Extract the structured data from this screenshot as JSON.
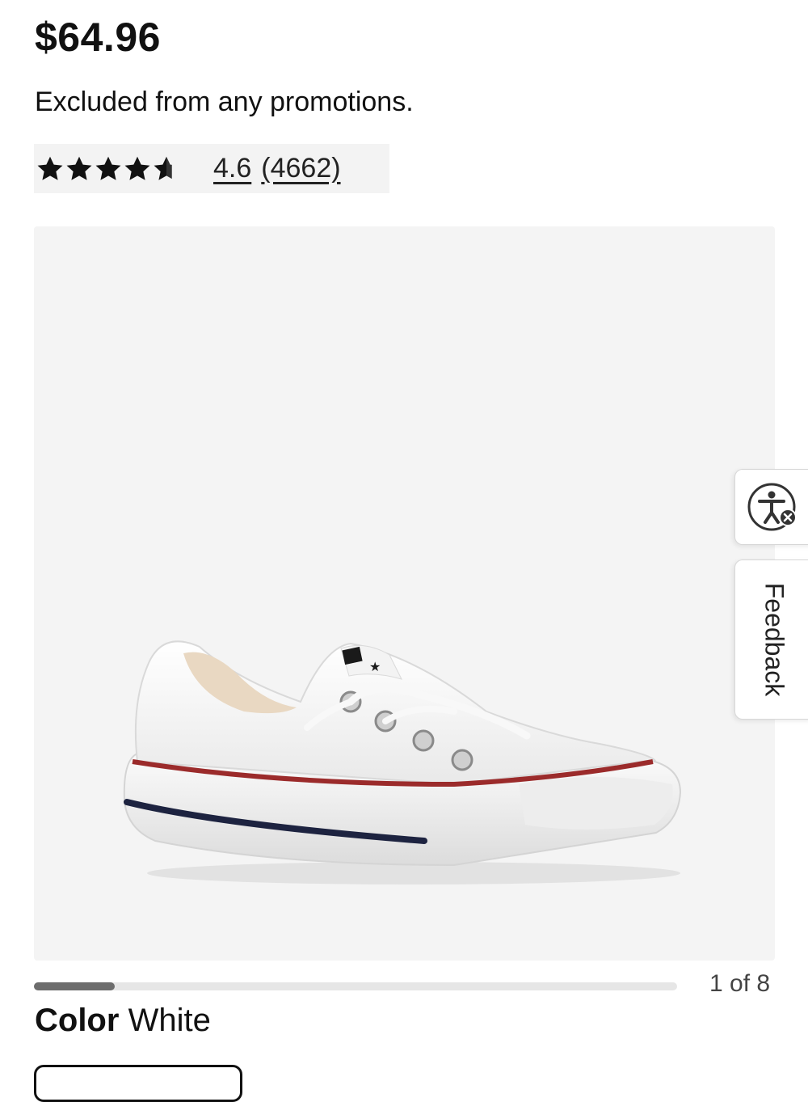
{
  "product": {
    "price": "$64.96",
    "promo_note": "Excluded from any promotions.",
    "rating": {
      "stars": 4.6,
      "value_text": "4.6",
      "count_text": "(4662)"
    }
  },
  "gallery": {
    "counter": "1 of 8",
    "current": 1,
    "total": 8
  },
  "color": {
    "label": "Color",
    "value": "White"
  },
  "side_tabs": {
    "accessibility_icon": "accessibility-icon",
    "feedback_label": "Feedback"
  },
  "colors": {
    "text": "#111111",
    "rating_bg": "#f3f3f3",
    "image_bg": "#f4f4f4",
    "progress_fill": "#6d6d6d",
    "progress_track": "#e6e6e6"
  }
}
